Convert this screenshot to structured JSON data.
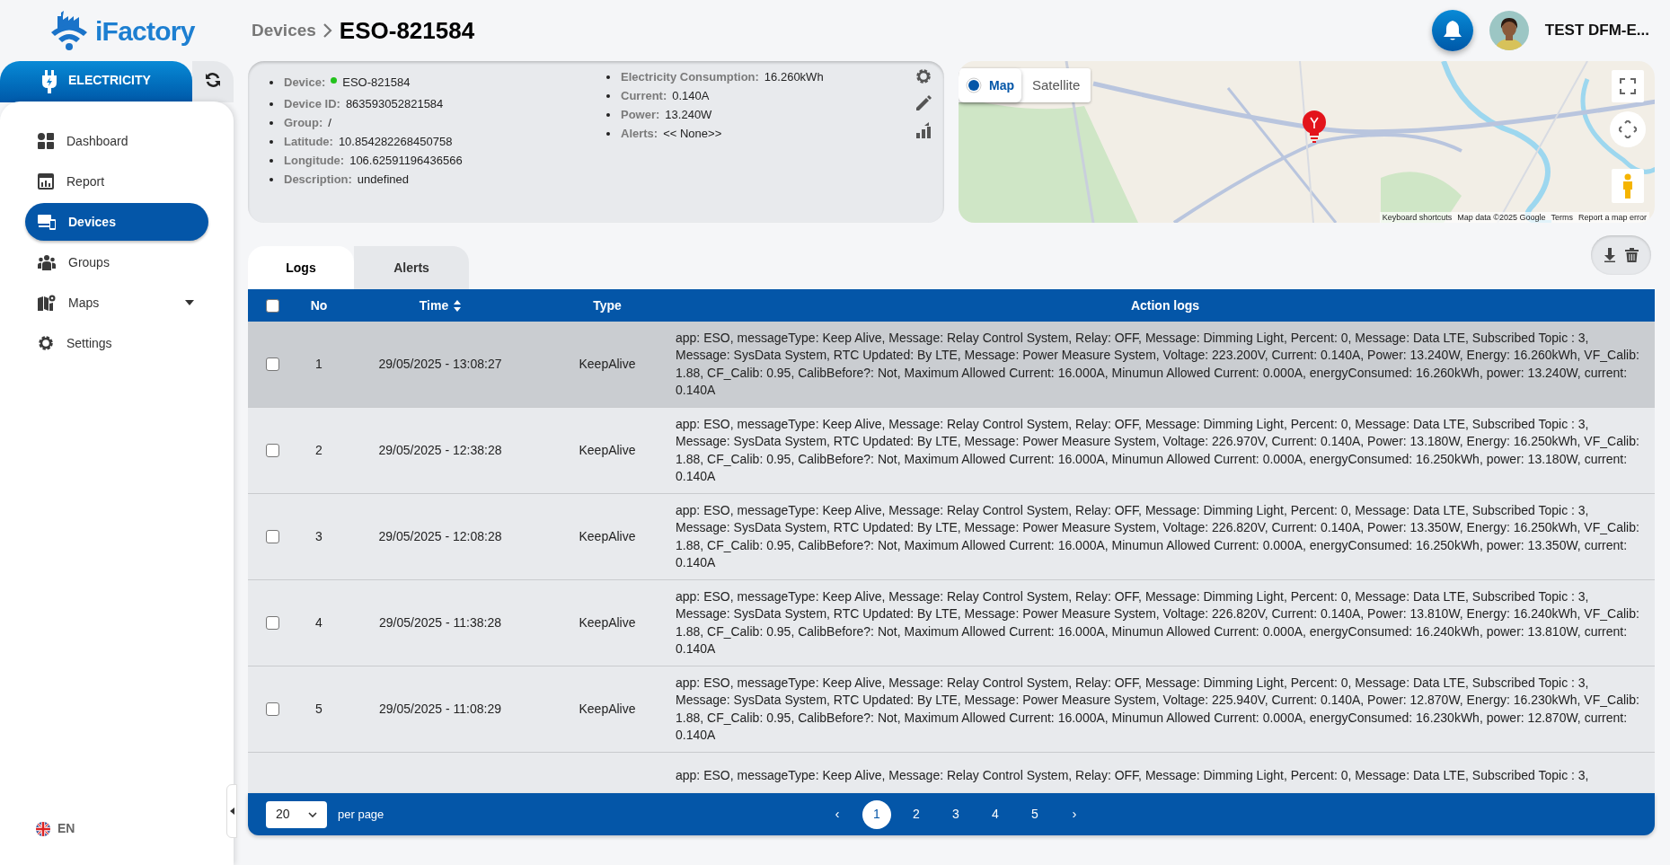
{
  "logo": {
    "text": "iFactory"
  },
  "breadcrumb": {
    "parent": "Devices",
    "current": "ESO-821584"
  },
  "user": {
    "name": "TEST DFM-E..."
  },
  "sidebar": {
    "module": "ELECTRICITY",
    "items": [
      {
        "label": "Dashboard",
        "kind": "dashboard",
        "selected": false
      },
      {
        "label": "Report",
        "kind": "report",
        "selected": false
      },
      {
        "label": "Devices",
        "kind": "devices",
        "selected": true
      },
      {
        "label": "Groups",
        "kind": "groups",
        "selected": false
      },
      {
        "label": "Maps",
        "kind": "maps",
        "selected": false,
        "expanded": false
      },
      {
        "label": "Settings",
        "kind": "settings",
        "selected": false
      }
    ],
    "language": "EN"
  },
  "device_info": {
    "online": true,
    "fields": [
      {
        "label": "Device:",
        "value": "ESO-821584"
      },
      {
        "label": "Device ID:",
        "value": "863593052821584"
      },
      {
        "label": "Group:",
        "value": "/"
      },
      {
        "label": "Latitude:",
        "value": "10.854282268450758"
      },
      {
        "label": "Longitude:",
        "value": "106.62591196436566"
      },
      {
        "label": "Description:",
        "value": "undefined"
      }
    ],
    "readings": [
      {
        "label": "Electricity Consumption:",
        "value": "16.260kWh"
      },
      {
        "label": "Current:",
        "value": "0.140A"
      },
      {
        "label": "Power:",
        "value": "13.240W"
      },
      {
        "label": "Alerts:",
        "value": "<< None>>"
      }
    ]
  },
  "map": {
    "map_types": [
      {
        "label": "Map",
        "selected": true
      },
      {
        "label": "Satellite",
        "selected": false
      }
    ],
    "attribution": [
      "Keyboard shortcuts",
      "Map data ©2025 Google",
      "Terms",
      "Report a map error"
    ]
  },
  "tabs": [
    {
      "label": "Logs",
      "selected": true
    },
    {
      "label": "Alerts",
      "selected": false
    }
  ],
  "table": {
    "select_all_checked": false,
    "columns": [
      {
        "label": "No",
        "sortable": false
      },
      {
        "label": "Time",
        "sortable": true
      },
      {
        "label": "Type",
        "sortable": false
      },
      {
        "label": "Action logs",
        "sortable": false
      }
    ],
    "rows": [
      {
        "checked": false,
        "highlighted": true,
        "no": "1",
        "time": "29/05/2025 - 13:08:27",
        "type": "KeepAlive",
        "action_log": "app: ESO, messageType: Keep Alive, Message: Relay Control System, Relay: OFF, Message: Dimming Light, Percent: 0, Message: Data LTE, Subscribed Topic : 3, Message: SysData System, RTC Updated: By LTE, Message: Power Measure System, Voltage: 223.200V, Current: 0.140A, Power: 13.240W, Energy: 16.260kWh, VF_Calib: 1.88, CF_Calib: 0.95, CalibBefore?: Not, Maximum Allowed Current: 16.000A, Minumun Allowed Current: 0.000A, energyConsumed: 16.260kWh, power: 13.240W, current: 0.140A"
      },
      {
        "checked": false,
        "highlighted": false,
        "no": "2",
        "time": "29/05/2025 - 12:38:28",
        "type": "KeepAlive",
        "action_log": "app: ESO, messageType: Keep Alive, Message: Relay Control System, Relay: OFF, Message: Dimming Light, Percent: 0, Message: Data LTE, Subscribed Topic : 3, Message: SysData System, RTC Updated: By LTE, Message: Power Measure System, Voltage: 226.970V, Current: 0.140A, Power: 13.180W, Energy: 16.250kWh, VF_Calib: 1.88, CF_Calib: 0.95, CalibBefore?: Not, Maximum Allowed Current: 16.000A, Minumun Allowed Current: 0.000A, energyConsumed: 16.250kWh, power: 13.180W, current: 0.140A"
      },
      {
        "checked": false,
        "highlighted": false,
        "no": "3",
        "time": "29/05/2025 - 12:08:28",
        "type": "KeepAlive",
        "action_log": "app: ESO, messageType: Keep Alive, Message: Relay Control System, Relay: OFF, Message: Dimming Light, Percent: 0, Message: Data LTE, Subscribed Topic : 3, Message: SysData System, RTC Updated: By LTE, Message: Power Measure System, Voltage: 226.820V, Current: 0.140A, Power: 13.350W, Energy: 16.250kWh, VF_Calib: 1.88, CF_Calib: 0.95, CalibBefore?: Not, Maximum Allowed Current: 16.000A, Minumun Allowed Current: 0.000A, energyConsumed: 16.250kWh, power: 13.350W, current: 0.140A"
      },
      {
        "checked": false,
        "highlighted": false,
        "no": "4",
        "time": "29/05/2025 - 11:38:28",
        "type": "KeepAlive",
        "action_log": "app: ESO, messageType: Keep Alive, Message: Relay Control System, Relay: OFF, Message: Dimming Light, Percent: 0, Message: Data LTE, Subscribed Topic : 3, Message: SysData System, RTC Updated: By LTE, Message: Power Measure System, Voltage: 226.820V, Current: 0.140A, Power: 13.810W, Energy: 16.240kWh, VF_Calib: 1.88, CF_Calib: 0.95, CalibBefore?: Not, Maximum Allowed Current: 16.000A, Minumun Allowed Current: 0.000A, energyConsumed: 16.240kWh, power: 13.810W, current: 0.140A"
      },
      {
        "checked": false,
        "highlighted": false,
        "no": "5",
        "time": "29/05/2025 - 11:08:29",
        "type": "KeepAlive",
        "action_log": "app: ESO, messageType: Keep Alive, Message: Relay Control System, Relay: OFF, Message: Dimming Light, Percent: 0, Message: Data LTE, Subscribed Topic : 3, Message: SysData System, RTC Updated: By LTE, Message: Power Measure System, Voltage: 225.940V, Current: 0.140A, Power: 12.870W, Energy: 16.230kWh, VF_Calib: 1.88, CF_Calib: 0.95, CalibBefore?: Not, Maximum Allowed Current: 16.000A, Minumun Allowed Current: 0.000A, energyConsumed: 16.230kWh, power: 12.870W, current: 0.140A"
      },
      {
        "action_log": "app: ESO, messageType: Keep Alive, Message: Relay Control System, Relay: OFF, Message: Dimming Light, Percent: 0, Message: Data LTE, Subscribed Topic : 3,"
      }
    ]
  },
  "pagination": {
    "page_size": "20",
    "per_page_label": "per page",
    "prev": "‹",
    "next": "›",
    "pages": [
      {
        "label": "1",
        "selected": true
      },
      {
        "label": "2",
        "selected": false
      },
      {
        "label": "3",
        "selected": false
      },
      {
        "label": "4",
        "selected": false
      },
      {
        "label": "5",
        "selected": false
      }
    ]
  }
}
